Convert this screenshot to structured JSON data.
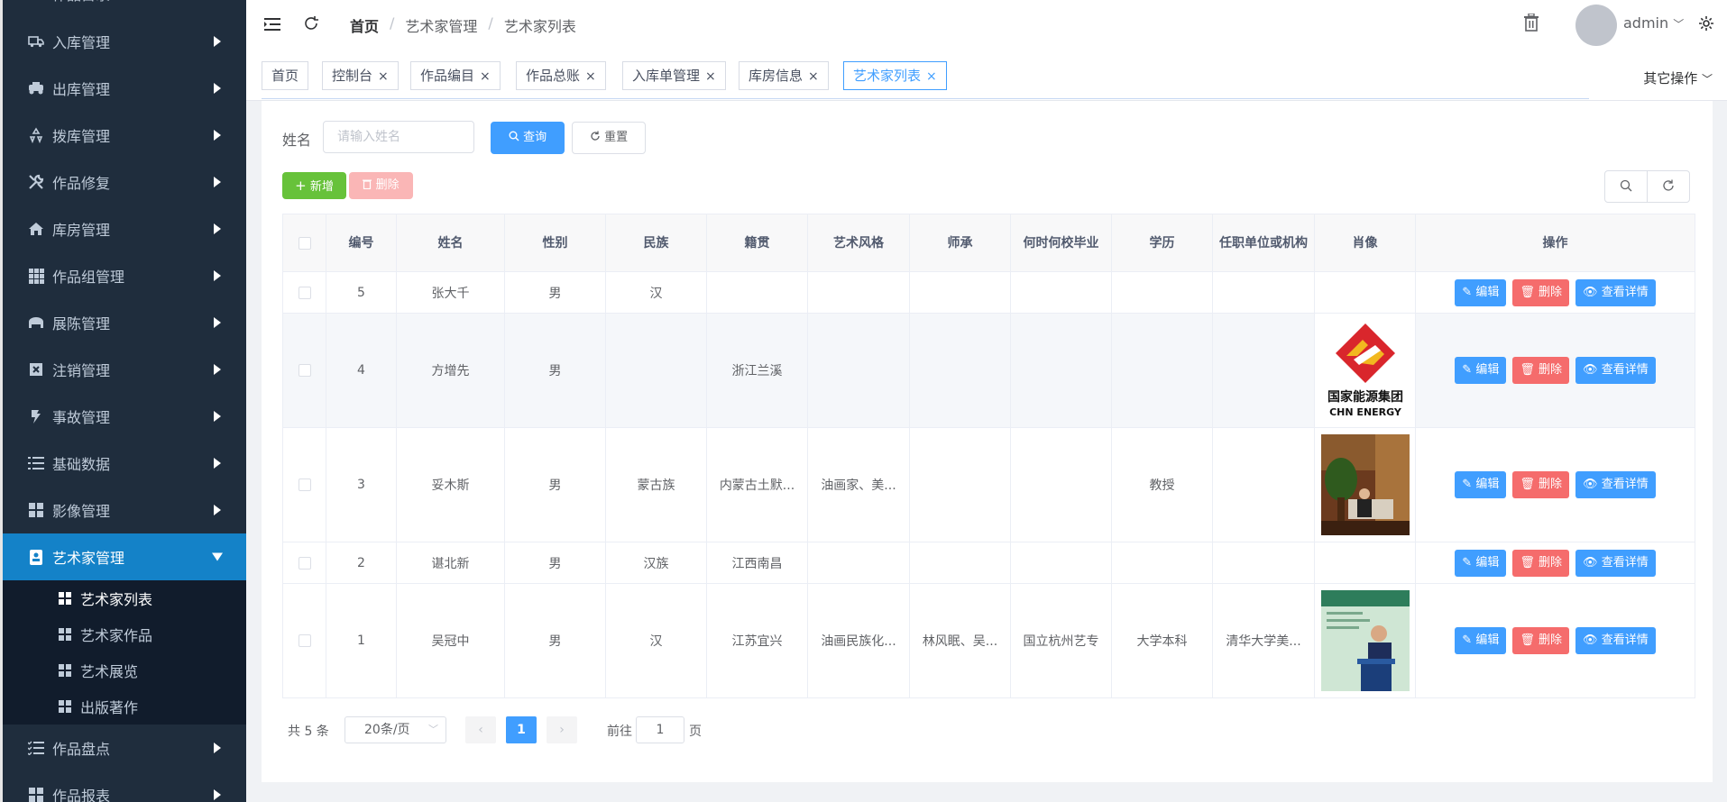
{
  "sidebar": {
    "top_cut_label": "作品目录",
    "items": [
      {
        "label": "入库管理",
        "icon": "truck-icon"
      },
      {
        "label": "出库管理",
        "icon": "vehicle-icon"
      },
      {
        "label": "拨库管理",
        "icon": "recycle-icon"
      },
      {
        "label": "作品修复",
        "icon": "tools-icon"
      },
      {
        "label": "库房管理",
        "icon": "home-icon"
      },
      {
        "label": "作品组管理",
        "icon": "grid-icon"
      },
      {
        "label": "展陈管理",
        "icon": "store-icon"
      },
      {
        "label": "注销管理",
        "icon": "cancel-icon"
      },
      {
        "label": "事故管理",
        "icon": "alert-icon"
      },
      {
        "label": "基础数据",
        "icon": "list-icon"
      },
      {
        "label": "影像管理",
        "icon": "image-grid-icon"
      },
      {
        "label": "艺术家管理",
        "icon": "badge-icon"
      }
    ],
    "sub_items": [
      {
        "label": "艺术家列表"
      },
      {
        "label": "艺术家作品"
      },
      {
        "label": "艺术展览"
      },
      {
        "label": "出版著作"
      }
    ],
    "bottom_items": [
      {
        "label": "作品盘点",
        "icon": "checklist-icon"
      },
      {
        "label": "作品报表",
        "icon": "report-icon"
      }
    ]
  },
  "header": {
    "breadcrumb": [
      "首页",
      "艺术家管理",
      "艺术家列表"
    ],
    "sep": "/",
    "username": "admin"
  },
  "tags": {
    "items": [
      "首页",
      "控制台",
      "作品编目",
      "作品总账",
      "入库单管理",
      "库房信息",
      "艺术家列表"
    ],
    "close": "×",
    "other_ops": "其它操作"
  },
  "search": {
    "name_label": "姓名",
    "name_placeholder": "请输入姓名",
    "query_btn": "查询",
    "reset_btn": "重置"
  },
  "toolbar": {
    "add_btn": "新增",
    "delete_btn": "删除"
  },
  "table": {
    "columns": [
      "编号",
      "姓名",
      "性别",
      "民族",
      "籍贯",
      "艺术风格",
      "师承",
      "何时何校毕业",
      "学历",
      "任职单位或机构",
      "肖像",
      "操作"
    ],
    "rows": [
      {
        "id": "5",
        "name": "张大千",
        "gender": "男",
        "ethnic": "汉",
        "hometown": "",
        "style": "",
        "mentor": "",
        "graduation": "",
        "education": "",
        "employer": "",
        "portrait": ""
      },
      {
        "id": "4",
        "name": "方增先",
        "gender": "男",
        "ethnic": "",
        "hometown": "浙江兰溪",
        "style": "",
        "mentor": "",
        "graduation": "",
        "education": "",
        "employer": "",
        "portrait": "logo"
      },
      {
        "id": "3",
        "name": "妥木斯",
        "gender": "男",
        "ethnic": "蒙古族",
        "hometown": "内蒙古土默...",
        "style": "油画家、美...",
        "mentor": "",
        "graduation": "",
        "education": "教授",
        "employer": "",
        "portrait": "photo1"
      },
      {
        "id": "2",
        "name": "谌北新",
        "gender": "男",
        "ethnic": "汉族",
        "hometown": "江西南昌",
        "style": "",
        "mentor": "",
        "graduation": "",
        "education": "",
        "employer": "",
        "portrait": ""
      },
      {
        "id": "1",
        "name": "吴冠中",
        "gender": "男",
        "ethnic": "汉",
        "hometown": "江苏宜兴",
        "style": "油画民族化...",
        "mentor": "林风眠、吴...",
        "graduation": "国立杭州艺专",
        "education": "大学本科",
        "employer": "清华大学美...",
        "portrait": "photo2"
      }
    ],
    "op_edit": "编辑",
    "op_delete": "删除",
    "op_view": "查看详情",
    "logo_text_cn": "国家能源集团",
    "logo_text_en": "CHN ENERGY"
  },
  "pagination": {
    "total": "共 5 条",
    "page_size": "20条/页",
    "current": "1",
    "goto_prefix": "前往",
    "goto_value": "1",
    "goto_suffix": "页"
  },
  "colors": {
    "sidebar_bg": "#1f2d3d",
    "active_menu": "#1482c8",
    "primary": "#409eff",
    "success": "#67c23a",
    "danger": "#f56c6c"
  }
}
